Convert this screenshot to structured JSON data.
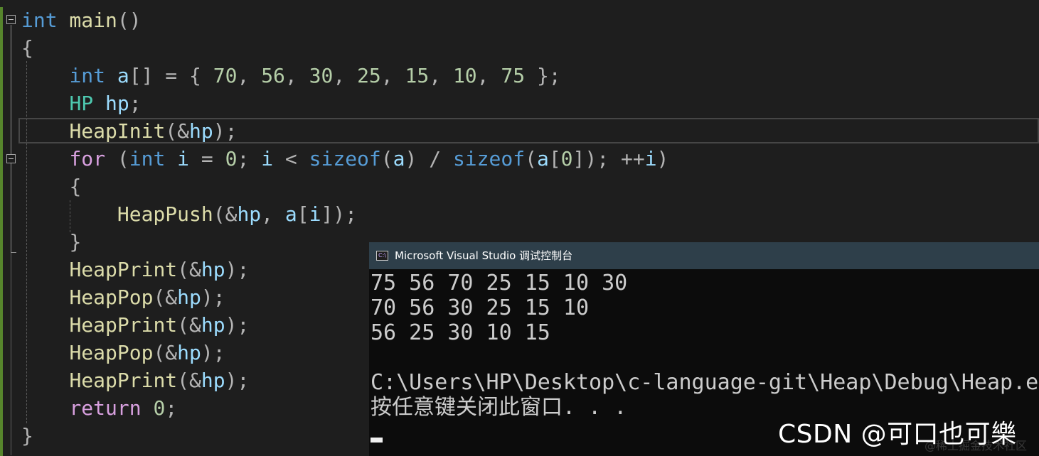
{
  "editor": {
    "lines": [
      {
        "tokens": [
          {
            "t": "int",
            "c": "kw"
          },
          {
            "t": " main",
            "c": "fn"
          },
          {
            "t": "()",
            "c": "op"
          }
        ]
      },
      {
        "tokens": [
          {
            "t": "{",
            "c": "op"
          }
        ]
      },
      {
        "tokens": [
          {
            "t": "    "
          },
          {
            "t": "int",
            "c": "kw"
          },
          {
            "t": " a",
            "c": "var"
          },
          {
            "t": "[] = { ",
            "c": "op"
          },
          {
            "t": "70",
            "c": "num"
          },
          {
            "t": ", ",
            "c": "op"
          },
          {
            "t": "56",
            "c": "num"
          },
          {
            "t": ", ",
            "c": "op"
          },
          {
            "t": "30",
            "c": "num"
          },
          {
            "t": ", ",
            "c": "op"
          },
          {
            "t": "25",
            "c": "num"
          },
          {
            "t": ", ",
            "c": "op"
          },
          {
            "t": "15",
            "c": "num"
          },
          {
            "t": ", ",
            "c": "op"
          },
          {
            "t": "10",
            "c": "num"
          },
          {
            "t": ", ",
            "c": "op"
          },
          {
            "t": "75",
            "c": "num"
          },
          {
            "t": " };",
            "c": "op"
          }
        ]
      },
      {
        "tokens": [
          {
            "t": "    "
          },
          {
            "t": "HP",
            "c": "type"
          },
          {
            "t": " hp",
            "c": "var"
          },
          {
            "t": ";",
            "c": "op"
          }
        ]
      },
      {
        "tokens": [
          {
            "t": "    "
          },
          {
            "t": "HeapInit",
            "c": "fn"
          },
          {
            "t": "(&",
            "c": "op"
          },
          {
            "t": "hp",
            "c": "var"
          },
          {
            "t": ");",
            "c": "op"
          }
        ]
      },
      {
        "tokens": [
          {
            "t": "    "
          },
          {
            "t": "for",
            "c": "ctl"
          },
          {
            "t": " (",
            "c": "op"
          },
          {
            "t": "int",
            "c": "kw"
          },
          {
            "t": " i",
            "c": "var"
          },
          {
            "t": " = ",
            "c": "op"
          },
          {
            "t": "0",
            "c": "num"
          },
          {
            "t": "; ",
            "c": "op"
          },
          {
            "t": "i",
            "c": "var"
          },
          {
            "t": " < ",
            "c": "op"
          },
          {
            "t": "sizeof",
            "c": "kw"
          },
          {
            "t": "(",
            "c": "op"
          },
          {
            "t": "a",
            "c": "var"
          },
          {
            "t": ") / ",
            "c": "op"
          },
          {
            "t": "sizeof",
            "c": "kw"
          },
          {
            "t": "(",
            "c": "op"
          },
          {
            "t": "a",
            "c": "var"
          },
          {
            "t": "[",
            "c": "op"
          },
          {
            "t": "0",
            "c": "num"
          },
          {
            "t": "]); ++",
            "c": "op"
          },
          {
            "t": "i",
            "c": "var"
          },
          {
            "t": ")",
            "c": "op"
          }
        ]
      },
      {
        "tokens": [
          {
            "t": "    "
          },
          {
            "t": "{",
            "c": "op"
          }
        ]
      },
      {
        "tokens": [
          {
            "t": "        "
          },
          {
            "t": "HeapPush",
            "c": "fn"
          },
          {
            "t": "(&",
            "c": "op"
          },
          {
            "t": "hp",
            "c": "var"
          },
          {
            "t": ", ",
            "c": "op"
          },
          {
            "t": "a",
            "c": "var"
          },
          {
            "t": "[",
            "c": "op"
          },
          {
            "t": "i",
            "c": "var"
          },
          {
            "t": "]);",
            "c": "op"
          }
        ]
      },
      {
        "tokens": [
          {
            "t": "    "
          },
          {
            "t": "}",
            "c": "op"
          }
        ]
      },
      {
        "tokens": [
          {
            "t": "    "
          },
          {
            "t": "HeapPrint",
            "c": "fn"
          },
          {
            "t": "(&",
            "c": "op"
          },
          {
            "t": "hp",
            "c": "var"
          },
          {
            "t": ");",
            "c": "op"
          }
        ]
      },
      {
        "tokens": [
          {
            "t": "    "
          },
          {
            "t": "HeapPop",
            "c": "fn"
          },
          {
            "t": "(&",
            "c": "op"
          },
          {
            "t": "hp",
            "c": "var"
          },
          {
            "t": ");",
            "c": "op"
          }
        ]
      },
      {
        "tokens": [
          {
            "t": "    "
          },
          {
            "t": "HeapPrint",
            "c": "fn"
          },
          {
            "t": "(&",
            "c": "op"
          },
          {
            "t": "hp",
            "c": "var"
          },
          {
            "t": ");",
            "c": "op"
          }
        ]
      },
      {
        "tokens": [
          {
            "t": "    "
          },
          {
            "t": "HeapPop",
            "c": "fn"
          },
          {
            "t": "(&",
            "c": "op"
          },
          {
            "t": "hp",
            "c": "var"
          },
          {
            "t": ");",
            "c": "op"
          }
        ]
      },
      {
        "tokens": [
          {
            "t": "    "
          },
          {
            "t": "HeapPrint",
            "c": "fn"
          },
          {
            "t": "(&",
            "c": "op"
          },
          {
            "t": "hp",
            "c": "var"
          },
          {
            "t": ");",
            "c": "op"
          }
        ]
      },
      {
        "tokens": [
          {
            "t": "    "
          },
          {
            "t": "return",
            "c": "ctl"
          },
          {
            "t": " ",
            "c": "op"
          },
          {
            "t": "0",
            "c": "num"
          },
          {
            "t": ";",
            "c": "op"
          }
        ]
      },
      {
        "tokens": [
          {
            "t": "}",
            "c": "op"
          }
        ]
      }
    ]
  },
  "console": {
    "title": "Microsoft Visual Studio 调试控制台",
    "icon": "visual-studio-console-icon",
    "icon_glyph": "C:\\",
    "output": [
      "75 56 70 25 15 10 30",
      "70 56 30 25 15 10",
      "56 25 30 10 15",
      "",
      "C:\\Users\\HP\\Desktop\\c-language-git\\Heap\\Debug\\Heap.ex",
      "按任意键关闭此窗口. . ."
    ]
  },
  "watermark": {
    "text": "CSDN @可口也可樂",
    "faint_text": "@稀土掘金技术社区"
  },
  "colors": {
    "editor_background": "#1e1e1e",
    "keyword": "#569cd6",
    "function": "#dcdcaa",
    "variable": "#9cdcfe",
    "number": "#b5cea8",
    "type": "#4ec9b0",
    "control": "#d8a0df",
    "console_background": "#0c0c0c",
    "console_titlebar": "#2e3f4a"
  }
}
